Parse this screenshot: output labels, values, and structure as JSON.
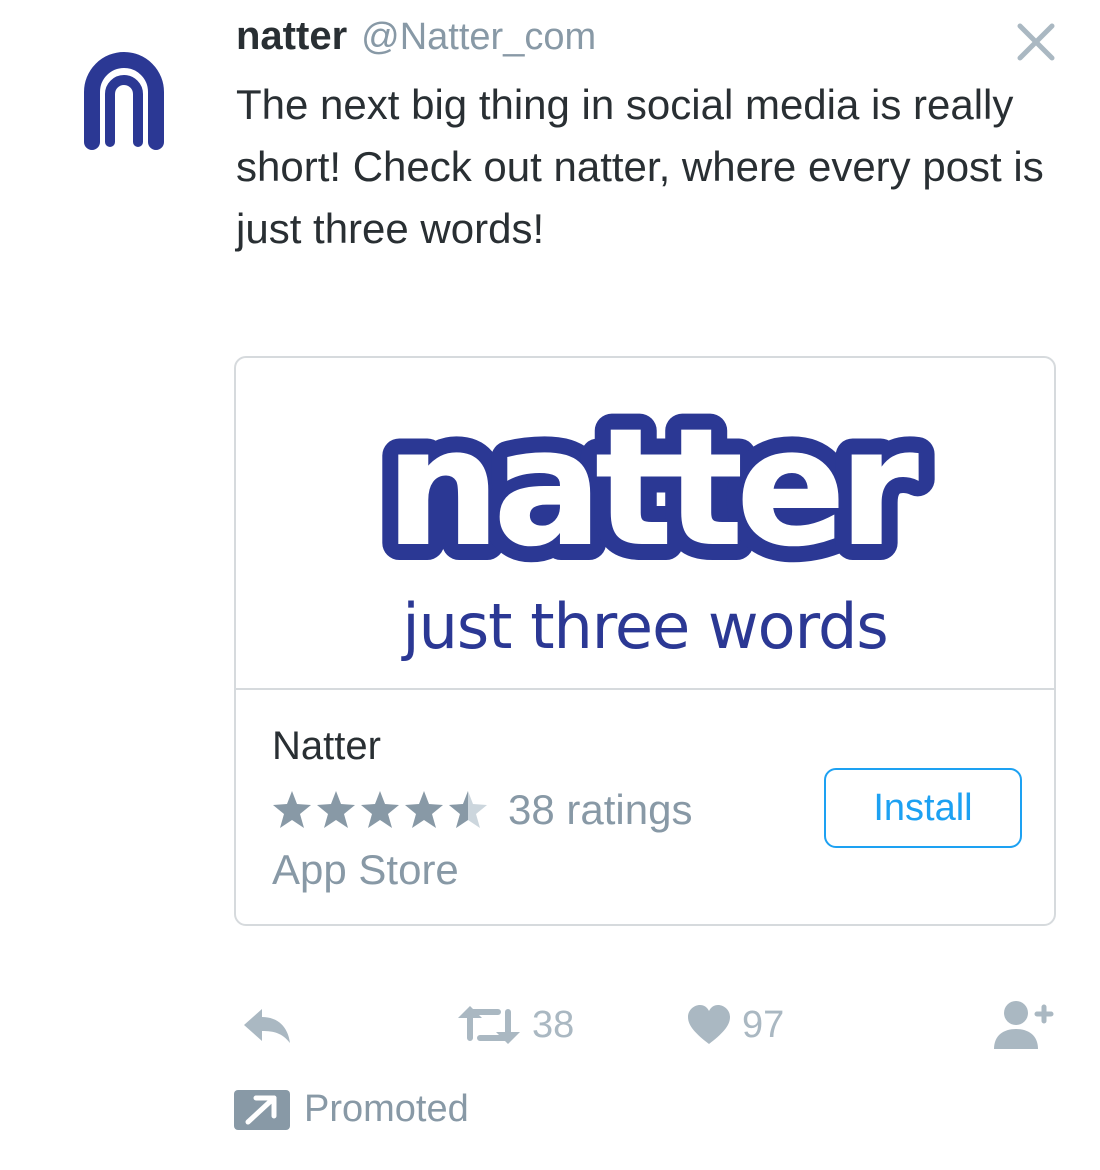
{
  "colors": {
    "brand": "#2b3894",
    "accent": "#1da1f2",
    "muted": "#8899a6",
    "icon": "#aab8c2",
    "text": "#292f33"
  },
  "tweet": {
    "avatar_icon": "natter-logo-icon",
    "display_name": "natter",
    "handle": "@Natter_com",
    "close_icon": "close-icon",
    "text": "The next big thing in social media is really short! Check out natter, where every post is just three words!"
  },
  "card": {
    "logo_text": "natter",
    "tagline": "just three words",
    "app_name": "Natter",
    "rating_stars": 4.5,
    "rating_max": 5,
    "ratings_label": "38 ratings",
    "store": "App Store",
    "install_label": "Install"
  },
  "actions": {
    "reply": {
      "icon": "reply-icon"
    },
    "retweet": {
      "icon": "retweet-icon",
      "count": "38"
    },
    "like": {
      "icon": "heart-icon",
      "count": "97"
    },
    "follow": {
      "icon": "follow-user-icon"
    }
  },
  "promoted": {
    "icon": "promoted-arrow-icon",
    "label": "Promoted"
  }
}
